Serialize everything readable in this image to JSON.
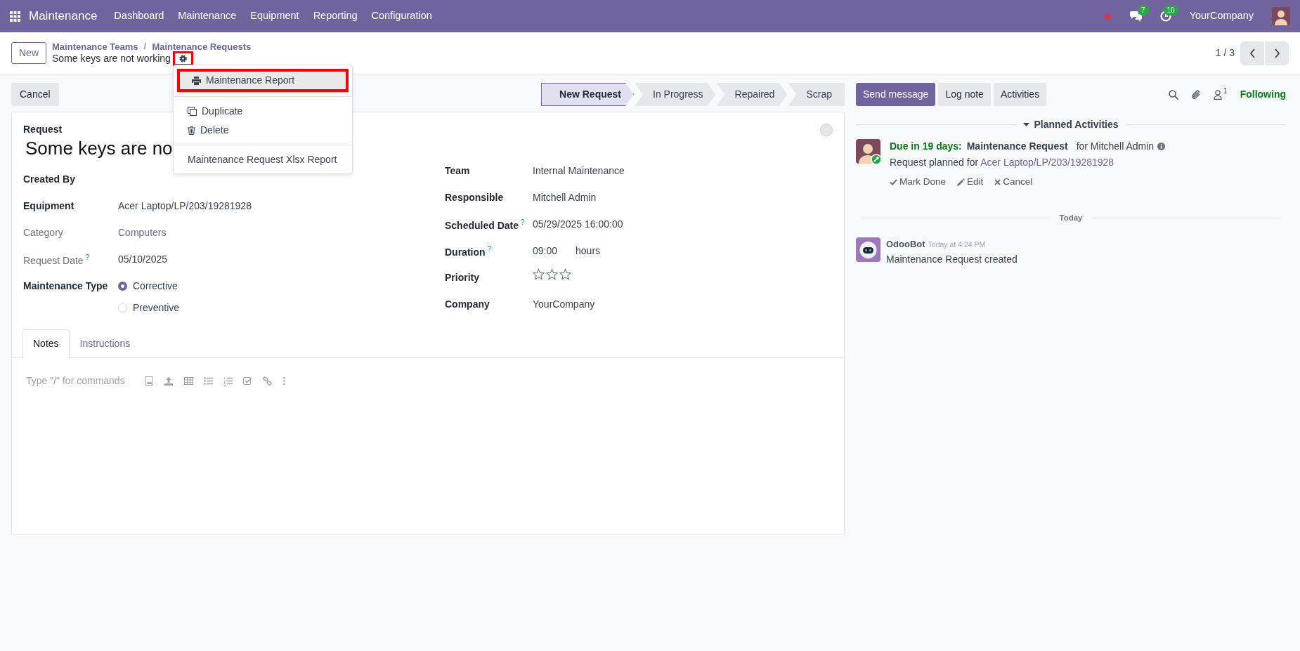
{
  "navbar": {
    "app": "Maintenance",
    "menu": [
      "Dashboard",
      "Maintenance",
      "Equipment",
      "Reporting",
      "Configuration"
    ],
    "messages_count": "7",
    "activities_count": "10",
    "company": "YourCompany"
  },
  "breadcrumb": {
    "new_button": "New",
    "items": [
      "Maintenance Teams",
      "Maintenance Requests"
    ],
    "separator": "/",
    "record": "Some keys are not working",
    "gear_highlighted": true
  },
  "pager": {
    "text": "1 / 3"
  },
  "action_menu": {
    "groups": [
      [
        {
          "kind": "print",
          "label": "Maintenance Report",
          "highlighted": true
        }
      ],
      [
        {
          "kind": "copy",
          "label": "Duplicate",
          "highlighted": false
        },
        {
          "kind": "trash",
          "label": "Delete",
          "highlighted": false
        }
      ],
      [
        {
          "kind": "plain",
          "label": "Maintenance Request Xlsx Report",
          "highlighted": false
        }
      ]
    ]
  },
  "cancel_button": "Cancel",
  "stages": [
    {
      "label": "New Request",
      "selected": true
    },
    {
      "label": "In Progress",
      "selected": false
    },
    {
      "label": "Repaired",
      "selected": false
    },
    {
      "label": "Scrap",
      "selected": false
    }
  ],
  "form": {
    "title_label": "Request",
    "title": "Some keys are no",
    "left_fields": [
      {
        "kind": "empty",
        "label": "Created By",
        "muted": false
      },
      {
        "kind": "text",
        "label": "Equipment",
        "muted": false,
        "value": "Acer Laptop/LP/203/19281928"
      },
      {
        "kind": "link",
        "label": "Category",
        "muted": true,
        "value": "Computers"
      },
      {
        "kind": "text",
        "label": "Request Date",
        "muted": true,
        "help": "?",
        "value": "05/10/2025"
      },
      {
        "kind": "radio",
        "label": "Maintenance Type",
        "muted": false,
        "options": [
          {
            "label": "Corrective",
            "selected": true
          },
          {
            "label": "Preventive",
            "selected": false
          }
        ]
      }
    ],
    "right_fields": [
      {
        "kind": "text",
        "label": "Team",
        "muted": false,
        "value": "Internal Maintenance"
      },
      {
        "kind": "text",
        "label": "Responsible",
        "muted": false,
        "value": "Mitchell Admin"
      },
      {
        "kind": "text",
        "label": "Scheduled Date",
        "muted": false,
        "help": "?",
        "value": "05/29/2025 16:00:00"
      },
      {
        "kind": "duration",
        "label": "Duration",
        "muted": false,
        "help": "?",
        "value": "09:00",
        "unit": "hours"
      },
      {
        "kind": "stars",
        "label": "Priority",
        "muted": false,
        "stars": 0
      },
      {
        "kind": "text",
        "label": "Company",
        "muted": false,
        "value": "YourCompany"
      }
    ]
  },
  "tabs": [
    {
      "label": "Notes",
      "selected": true
    },
    {
      "label": "Instructions",
      "selected": false
    }
  ],
  "editor": {
    "placeholder": "Type \"/\" for commands"
  },
  "chatter": {
    "buttons": [
      {
        "label": "Send message",
        "primary": true
      },
      {
        "label": "Log note",
        "primary": false
      },
      {
        "label": "Activities",
        "primary": false
      }
    ],
    "followers_count": "1",
    "following": "Following",
    "planned_title": "Planned Activities",
    "activity": {
      "due": "Due in 19 days:",
      "summary": "Maintenance Request",
      "assignee": "for Mitchell Admin",
      "note_prefix": "Request planned for",
      "note_link": "Acer Laptop/LP/203/19281928",
      "actions": [
        {
          "kind": "check",
          "label": "Mark Done"
        },
        {
          "kind": "pencil",
          "label": "Edit"
        },
        {
          "kind": "cross",
          "label": "Cancel"
        }
      ]
    },
    "date_separator": "Today",
    "message": {
      "author": "OdooBot",
      "time": "Today at 4:24 PM",
      "body": "Maintenance Request created"
    }
  }
}
